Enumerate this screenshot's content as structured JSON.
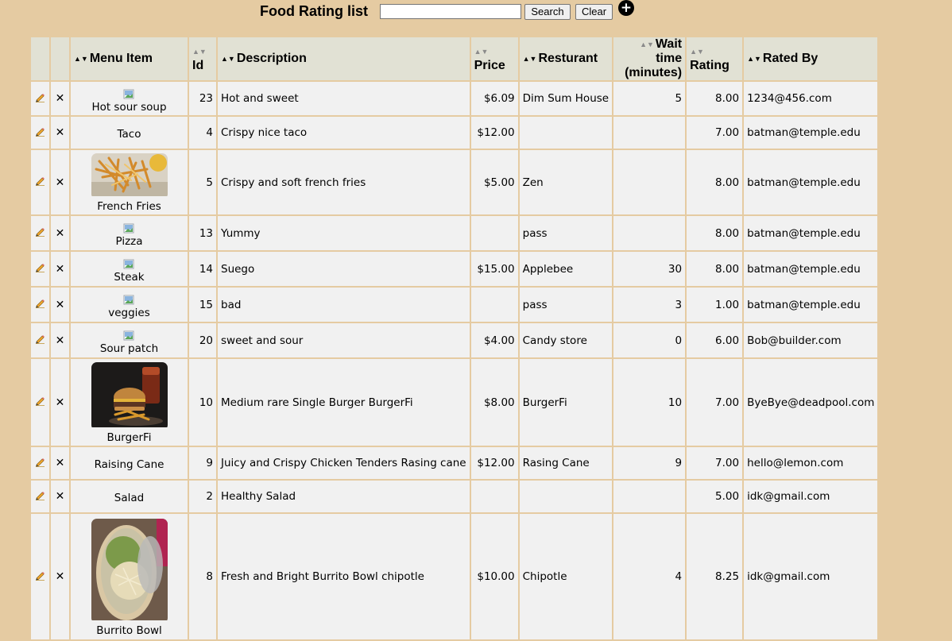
{
  "header": {
    "title": "Food Rating list",
    "search_value": "",
    "search_label": "Search",
    "clear_label": "Clear",
    "add_symbol": "+"
  },
  "table": {
    "columns": {
      "menu_item": "Menu Item",
      "id": "Id",
      "description": "Description",
      "price": "Price",
      "restaurant": "Resturant",
      "wait_line1": "Wait time",
      "wait_line2": "(minutes)",
      "rating": "Rating",
      "rated_by": "Rated By"
    },
    "delete_symbol": "✕",
    "rows": [
      {
        "menu_item": "Hot sour soup",
        "image": "broken",
        "id": "23",
        "description": "Hot and sweet",
        "price": "$6.09",
        "restaurant": "Dim Sum House",
        "wait": "5",
        "rating": "8.00",
        "rated_by": "1234@456.com"
      },
      {
        "menu_item": "Taco",
        "image": "none",
        "id": "4",
        "description": "Crispy nice taco",
        "price": "$12.00",
        "restaurant": "",
        "wait": "",
        "rating": "7.00",
        "rated_by": "batman@temple.edu"
      },
      {
        "menu_item": "French Fries",
        "image": "fries-photo",
        "id": "5",
        "description": "Crispy and soft french fries",
        "price": "$5.00",
        "restaurant": "Zen",
        "wait": "",
        "rating": "8.00",
        "rated_by": "batman@temple.edu"
      },
      {
        "menu_item": "Pizza",
        "image": "broken",
        "id": "13",
        "description": "Yummy",
        "price": "",
        "restaurant": "pass",
        "wait": "",
        "rating": "8.00",
        "rated_by": "batman@temple.edu"
      },
      {
        "menu_item": "Steak",
        "image": "broken",
        "id": "14",
        "description": "Suego",
        "price": "$15.00",
        "restaurant": "Applebee",
        "wait": "30",
        "rating": "8.00",
        "rated_by": "batman@temple.edu"
      },
      {
        "menu_item": "veggies",
        "image": "broken",
        "id": "15",
        "description": "bad",
        "price": "",
        "restaurant": "pass",
        "wait": "3",
        "rating": "1.00",
        "rated_by": "batman@temple.edu"
      },
      {
        "menu_item": "Sour patch",
        "image": "broken",
        "id": "20",
        "description": "sweet and sour",
        "price": "$4.00",
        "restaurant": "Candy store",
        "wait": "0",
        "rating": "6.00",
        "rated_by": "Bob@builder.com"
      },
      {
        "menu_item": "BurgerFi",
        "image": "burger-photo",
        "id": "10",
        "description": "Medium rare Single Burger BurgerFi",
        "price": "$8.00",
        "restaurant": "BurgerFi",
        "wait": "10",
        "rating": "7.00",
        "rated_by": "ByeBye@deadpool.com"
      },
      {
        "menu_item": "Raising Cane",
        "image": "none",
        "id": "9",
        "description": "Juicy and Crispy Chicken Tenders Rasing cane",
        "price": "$12.00",
        "restaurant": "Rasing Cane",
        "wait": "9",
        "rating": "7.00",
        "rated_by": "hello@lemon.com"
      },
      {
        "menu_item": "Salad",
        "image": "none",
        "id": "2",
        "description": "Healthy Salad",
        "price": "",
        "restaurant": "",
        "wait": "",
        "rating": "5.00",
        "rated_by": "idk@gmail.com"
      },
      {
        "menu_item": "Burrito Bowl",
        "image": "burrito-bowl-photo",
        "id": "8",
        "description": "Fresh and Bright Burrito Bowl chipotle",
        "price": "$10.00",
        "restaurant": "Chipotle",
        "wait": "4",
        "rating": "8.25",
        "rated_by": "idk@gmail.com"
      }
    ]
  },
  "colors": {
    "page_background": "#e5cba2",
    "header_background": "#e1e1d4",
    "cell_background": "#f1f1f1"
  }
}
